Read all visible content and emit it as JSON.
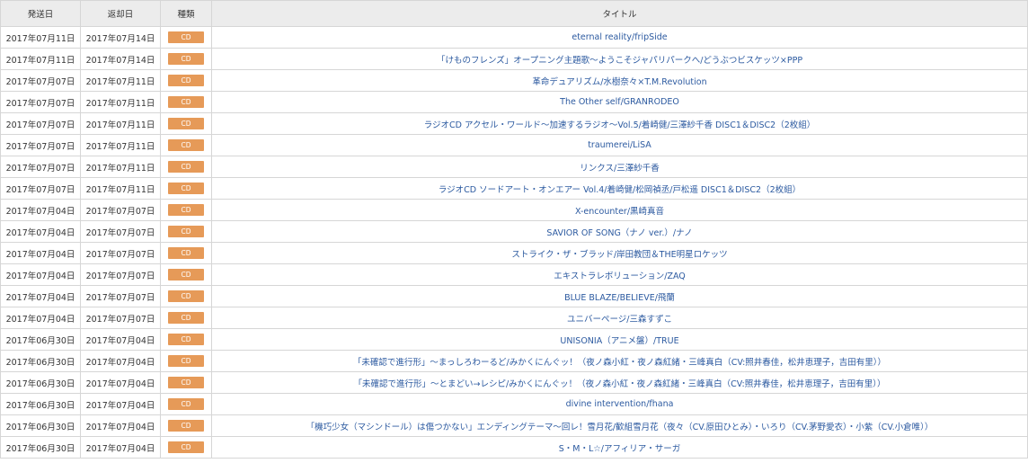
{
  "table": {
    "headers": {
      "ship_date": "発送日",
      "return_date": "返却日",
      "type": "種類",
      "title": "タイトル"
    },
    "rows": [
      {
        "ship": "2017年07月11日",
        "return": "2017年07月14日",
        "type": "CD",
        "title": "eternal reality/fripSide"
      },
      {
        "ship": "2017年07月11日",
        "return": "2017年07月14日",
        "type": "CD",
        "title": "「けものフレンズ」オープニング主題歌〜ようこそジャパリパークへ/どうぶつビスケッツ×PPP"
      },
      {
        "ship": "2017年07月07日",
        "return": "2017年07月11日",
        "type": "CD",
        "title": "革命デュアリズム/水樹奈々×T.M.Revolution"
      },
      {
        "ship": "2017年07月07日",
        "return": "2017年07月11日",
        "type": "CD",
        "title": "The Other self/GRANRODEO"
      },
      {
        "ship": "2017年07月07日",
        "return": "2017年07月11日",
        "type": "CD",
        "title": "ラジオCD アクセル・ワールド〜加速するラジオ〜Vol.5/着崎健/三澤紗千香 DISC1＆DISC2（2枚組）"
      },
      {
        "ship": "2017年07月07日",
        "return": "2017年07月11日",
        "type": "CD",
        "title": "traumerei/LiSA"
      },
      {
        "ship": "2017年07月07日",
        "return": "2017年07月11日",
        "type": "CD",
        "title": "リンクス/三澤紗千香"
      },
      {
        "ship": "2017年07月07日",
        "return": "2017年07月11日",
        "type": "CD",
        "title": "ラジオCD ソードアート・オンエアー Vol.4/着崎健/松岡禎丞/戸松遥 DISC1＆DISC2（2枚組）"
      },
      {
        "ship": "2017年07月04日",
        "return": "2017年07月07日",
        "type": "CD",
        "title": "X-encounter/黒崎真音"
      },
      {
        "ship": "2017年07月04日",
        "return": "2017年07月07日",
        "type": "CD",
        "title": "SAVIOR OF SONG（ナノ ver.）/ナノ"
      },
      {
        "ship": "2017年07月04日",
        "return": "2017年07月07日",
        "type": "CD",
        "title": "ストライク・ザ・ブラッド/岸田教団＆THE明星ロケッツ"
      },
      {
        "ship": "2017年07月04日",
        "return": "2017年07月07日",
        "type": "CD",
        "title": "エキストラレボリューション/ZAQ"
      },
      {
        "ship": "2017年07月04日",
        "return": "2017年07月07日",
        "type": "CD",
        "title": "BLUE BLAZE/BELIEVE/飛蘭"
      },
      {
        "ship": "2017年07月04日",
        "return": "2017年07月07日",
        "type": "CD",
        "title": "ユニバーページ/三森すずこ"
      },
      {
        "ship": "2017年06月30日",
        "return": "2017年07月04日",
        "type": "CD",
        "title": "UNISONIA（アニメ盤）/TRUE"
      },
      {
        "ship": "2017年06月30日",
        "return": "2017年07月04日",
        "type": "CD",
        "title": "「未確認で進行形」〜まっしろわーるど/みかくにんぐッ！（夜ノ森小紅・夜ノ森紅緒・三峰真白（CV:照井春佳，松井恵理子，吉田有里））"
      },
      {
        "ship": "2017年06月30日",
        "return": "2017年07月04日",
        "type": "CD",
        "title": "「未確認で進行形」〜とまどい→レシピ/みかくにんぐッ！（夜ノ森小紅・夜ノ森紅緒・三峰真白（CV:照井春佳，松井恵理子，吉田有里））"
      },
      {
        "ship": "2017年06月30日",
        "return": "2017年07月04日",
        "type": "CD",
        "title": "divine intervention/fhana"
      },
      {
        "ship": "2017年06月30日",
        "return": "2017年07月04日",
        "type": "CD",
        "title": "「機巧少女（マシンドール）は傷つかない」エンディングテーマ〜回レ！雪月花/歓組雪月花（夜々（CV.原田ひとみ）・いろり（CV.茅野愛衣）・小紫（CV.小倉唯））"
      },
      {
        "ship": "2017年06月30日",
        "return": "2017年07月04日",
        "type": "CD",
        "title": "S・M・L☆/アフィリア・サーガ"
      }
    ]
  },
  "colors": {
    "badge_bg": "#e69a58",
    "link": "#2c5aa0",
    "header_bg": "#ececec",
    "border": "#d6d6d6"
  }
}
